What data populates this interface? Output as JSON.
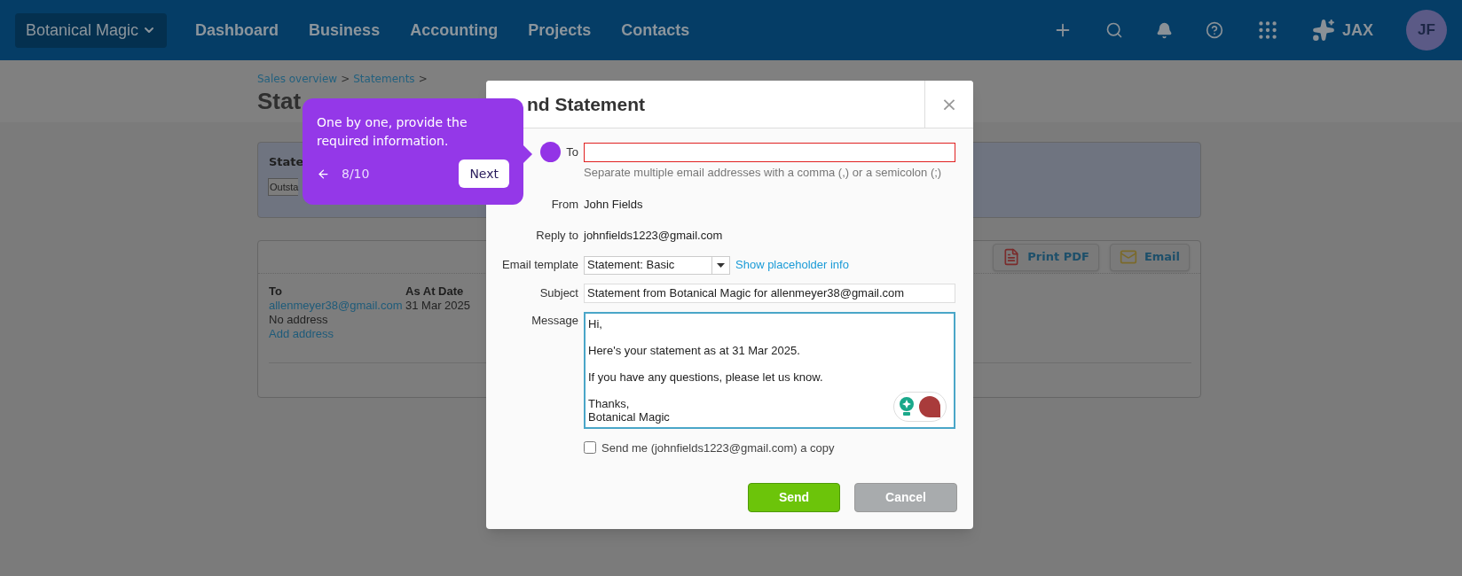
{
  "header": {
    "org": "Botanical Magic",
    "nav": [
      "Dashboard",
      "Business",
      "Accounting",
      "Projects",
      "Contacts"
    ],
    "assistant": "JAX",
    "avatar": "JF"
  },
  "page": {
    "breadcrumbs": [
      {
        "label": "Sales overview",
        "separator": ">"
      },
      {
        "label": "Statements",
        "separator": ">"
      }
    ],
    "title": "Stat",
    "filter_panel": {
      "label": "State",
      "select": "Outsta"
    },
    "actions": [
      "Print PDF",
      "Email"
    ],
    "columns": [
      {
        "heading": "To",
        "lines": [
          {
            "text": "allenmeyer38@gmail.com",
            "kind": "link"
          },
          {
            "text": "No address",
            "kind": "text"
          },
          {
            "text": "Add address",
            "kind": "link"
          }
        ]
      },
      {
        "heading": "As At Date",
        "lines": [
          {
            "text": "31 Mar 2025",
            "kind": "text"
          }
        ]
      }
    ]
  },
  "dialog": {
    "title": "nd Statement",
    "close": "×",
    "to": {
      "label": "To",
      "error": true,
      "hint": "Separate multiple email addresses with a comma (,) or a semicolon (;)"
    },
    "from": {
      "label": "From",
      "value": "John Fields"
    },
    "reply_to": {
      "label": "Reply to",
      "value": "johnfields1223@gmail.com"
    },
    "template": {
      "label": "Email template",
      "value": "Statement: Basic",
      "link": "Show placeholder info"
    },
    "subject": {
      "label": "Subject",
      "value": "Statement from Botanical Magic for allenmeyer38@gmail.com"
    },
    "message": {
      "label": "Message",
      "paragraphs": [
        "Hi,",
        "Here's your statement as at 31 Mar 2025.",
        "If you have any questions, please let us know.",
        "Thanks,\nBotanical Magic"
      ]
    },
    "copy": {
      "label": "Send me (johnfields1223@gmail.com) a copy",
      "checked": false
    },
    "buttons": [
      {
        "label": "Send",
        "kind": "primary"
      },
      {
        "label": "Cancel",
        "kind": "secondary"
      }
    ]
  },
  "tour": {
    "text": "One by one, provide the required information.",
    "step": "8/10",
    "next": "Next"
  }
}
